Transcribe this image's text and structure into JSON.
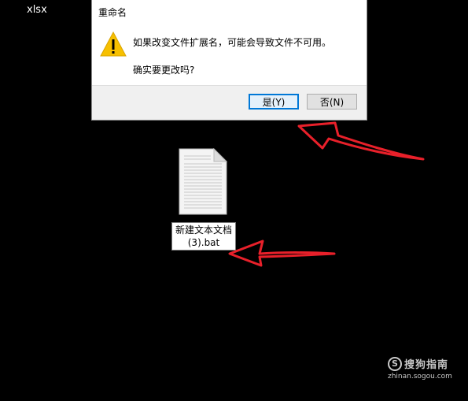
{
  "desktop": {
    "label": "xlsx"
  },
  "dialog": {
    "title": "重命名",
    "message": "如果改变文件扩展名，可能会导致文件不可用。",
    "question": "确实要更改吗?",
    "yes_label": "是(Y)",
    "no_label": "否(N)"
  },
  "file": {
    "name_line1": "新建文本文档",
    "name_line2": "(3).bat",
    "icon": "text-file-icon"
  },
  "annotations": {
    "arrow_color": "#e8202a"
  },
  "watermark": {
    "logo_glyph": "S",
    "name": "搜狗指南",
    "url": "zhinan.sogou.com"
  },
  "icons": {
    "warning": "warning-icon"
  }
}
